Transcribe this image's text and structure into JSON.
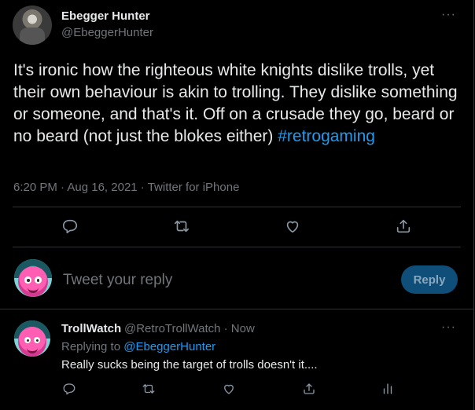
{
  "main_tweet": {
    "author_name": "Ebegger Hunter",
    "author_handle": "@EbeggerHunter",
    "more_glyph": "···",
    "text_before_hashtag": "It's ironic how the righteous white knights dislike trolls, yet their own behaviour is akin to trolling. They dislike something or someone, and that's it. Off on a crusade they go, beard or no beard (not just the blokes either)",
    "hashtag": "#retrogaming",
    "time": "6:20 PM",
    "date": "Aug 16, 2021",
    "source": "Twitter for iPhone",
    "meta_sep": " · "
  },
  "reply_box": {
    "placeholder": "Tweet your reply",
    "button_label": "Reply"
  },
  "reply_tweet": {
    "author_name": "TrollWatch",
    "author_handle": "@RetroTrollWatch · Now",
    "more_glyph": "···",
    "replying_prefix": "Replying to ",
    "replying_to": "@EbeggerHunter",
    "text": "Really sucks being the target of trolls doesn't it...."
  },
  "icons": {
    "reply": "reply-icon",
    "retweet": "retweet-icon",
    "like": "heart-icon",
    "share": "share-icon",
    "analytics": "analytics-icon"
  },
  "colors": {
    "background": "#000000",
    "text_primary": "#e7e9ea",
    "text_secondary": "#71767b",
    "link": "#1d9bf0",
    "reply_button_bg": "#0f4e78",
    "divider": "#2f3336"
  }
}
